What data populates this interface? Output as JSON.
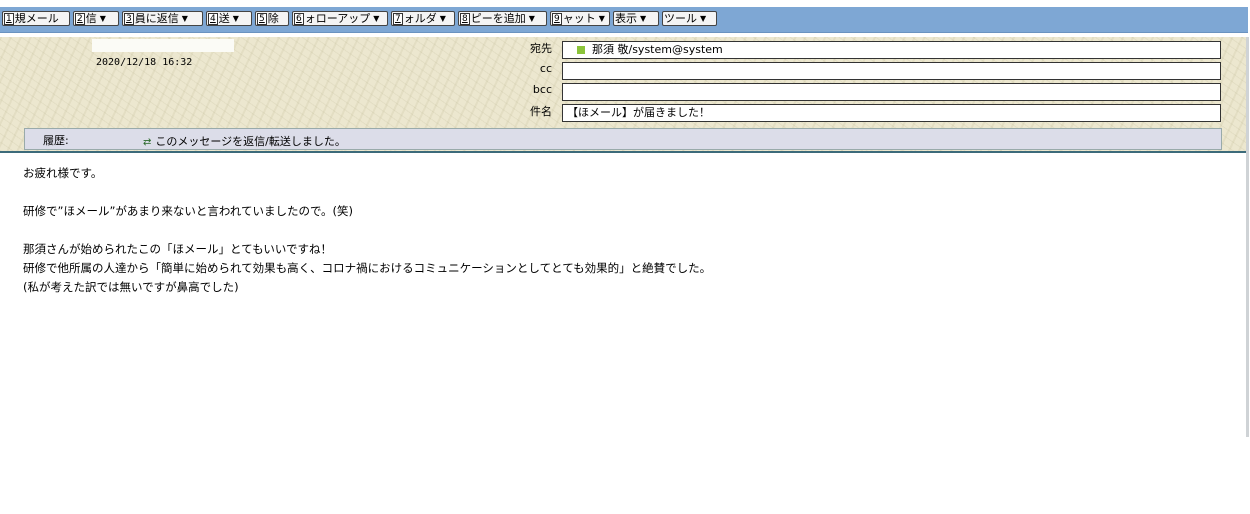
{
  "toolbar": {
    "buttons": [
      {
        "key": "1",
        "label": "規メール",
        "dropdown": false
      },
      {
        "key": "2",
        "label": "信",
        "dropdown": true
      },
      {
        "key": "3",
        "label": "員に返信",
        "dropdown": true
      },
      {
        "key": "4",
        "label": "送",
        "dropdown": true
      },
      {
        "key": "5",
        "label": "除",
        "dropdown": false
      },
      {
        "key": "6",
        "label": "ォローアップ",
        "dropdown": true
      },
      {
        "key": "7",
        "label": "ォルダ",
        "dropdown": true
      },
      {
        "key": "8",
        "label": "ピーを追加",
        "dropdown": true
      },
      {
        "key": "9",
        "label": "ャット",
        "dropdown": true
      },
      {
        "key": "",
        "label": "表示",
        "dropdown": true
      },
      {
        "key": "",
        "label": "ツール",
        "dropdown": true
      }
    ]
  },
  "header": {
    "date": "2020/12/18 16:32",
    "to_label": "宛先",
    "to_value": "那須 敬/system@system",
    "cc_label": "cc",
    "cc_value": "",
    "bcc_label": "bcc",
    "bcc_value": "",
    "subject_label": "件名",
    "subject_value": "【ほメール】が届きました！"
  },
  "history": {
    "label": "履歴:",
    "message": "このメッセージを返信/転送しました。"
  },
  "body": {
    "lines": [
      "お疲れ様です。",
      "",
      "研修で”ほメール”があまり来ないと言われていましたので。(笑)",
      "",
      "那須さんが始められたこの「ほメール」とてもいいですね！",
      "研修で他所属の人達から「簡単に始められて効果も高く、コロナ禍におけるコミュニケーションとしてとても効果的」と絶賛でした。",
      "(私が考えた訳では無いですが鼻高でした)"
    ]
  },
  "colors": {
    "toolbar_bg": "#7ea7d4",
    "header_bg": "#ece7cf",
    "history_bg": "#dcdde9",
    "recipient_marker": "#8bc43a"
  }
}
